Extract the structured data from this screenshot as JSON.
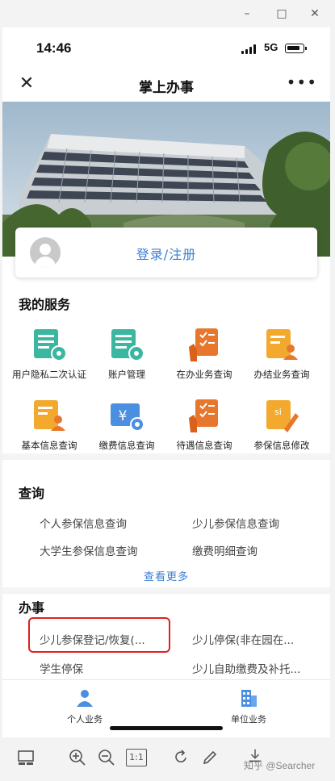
{
  "window": {
    "minimize_glyph": "–",
    "maximize_glyph": "□",
    "close_glyph": "✕"
  },
  "status_bar": {
    "time": "14:46",
    "network": "5G"
  },
  "nav": {
    "title": "掌上办事",
    "close_glyph": "✕",
    "more_glyph": "•••"
  },
  "login": {
    "label": "登录/注册"
  },
  "my_services": {
    "title": "我的服务",
    "items": [
      {
        "label": "用户隐私二次认证",
        "icon": "doc-gear-icon",
        "color": "#3bb6a0"
      },
      {
        "label": "账户管理",
        "icon": "doc-gear-icon",
        "color": "#3bb6a0"
      },
      {
        "label": "在办业务查询",
        "icon": "hand-checklist-icon",
        "color": "#e8772e"
      },
      {
        "label": "办结业务查询",
        "icon": "doc-person-icon",
        "color": "#f2a92e"
      },
      {
        "label": "基本信息查询",
        "icon": "doc-person-icon",
        "color": "#f2a92e"
      },
      {
        "label": "缴费信息查询",
        "icon": "yen-gear-icon",
        "color": "#4a8fe0"
      },
      {
        "label": "待遇信息查询",
        "icon": "hand-checklist-icon",
        "color": "#e8772e"
      },
      {
        "label": "参保信息修改",
        "icon": "si-pencil-icon",
        "color": "#f2a92e"
      }
    ]
  },
  "query": {
    "title": "查询",
    "items": [
      "个人参保信息查询",
      "少儿参保信息查询",
      "大学生参保信息查询",
      "缴费明细查询"
    ],
    "more": "查看更多"
  },
  "affairs": {
    "title": "办事",
    "items": [
      "少儿参保登记/恢复(...",
      "少儿停保(非在园在...",
      "学生停保",
      "少儿自助缴费及补托..."
    ]
  },
  "tabbar": {
    "items": [
      {
        "label": "个人业务",
        "icon": "person-icon"
      },
      {
        "label": "单位业务",
        "icon": "building-icon"
      }
    ]
  },
  "toolbar": {
    "watermark": "知乎 @Searcher",
    "one_to_one": "1:1"
  },
  "colors": {
    "accent": "#3a7fd1",
    "highlight": "#e02020"
  }
}
